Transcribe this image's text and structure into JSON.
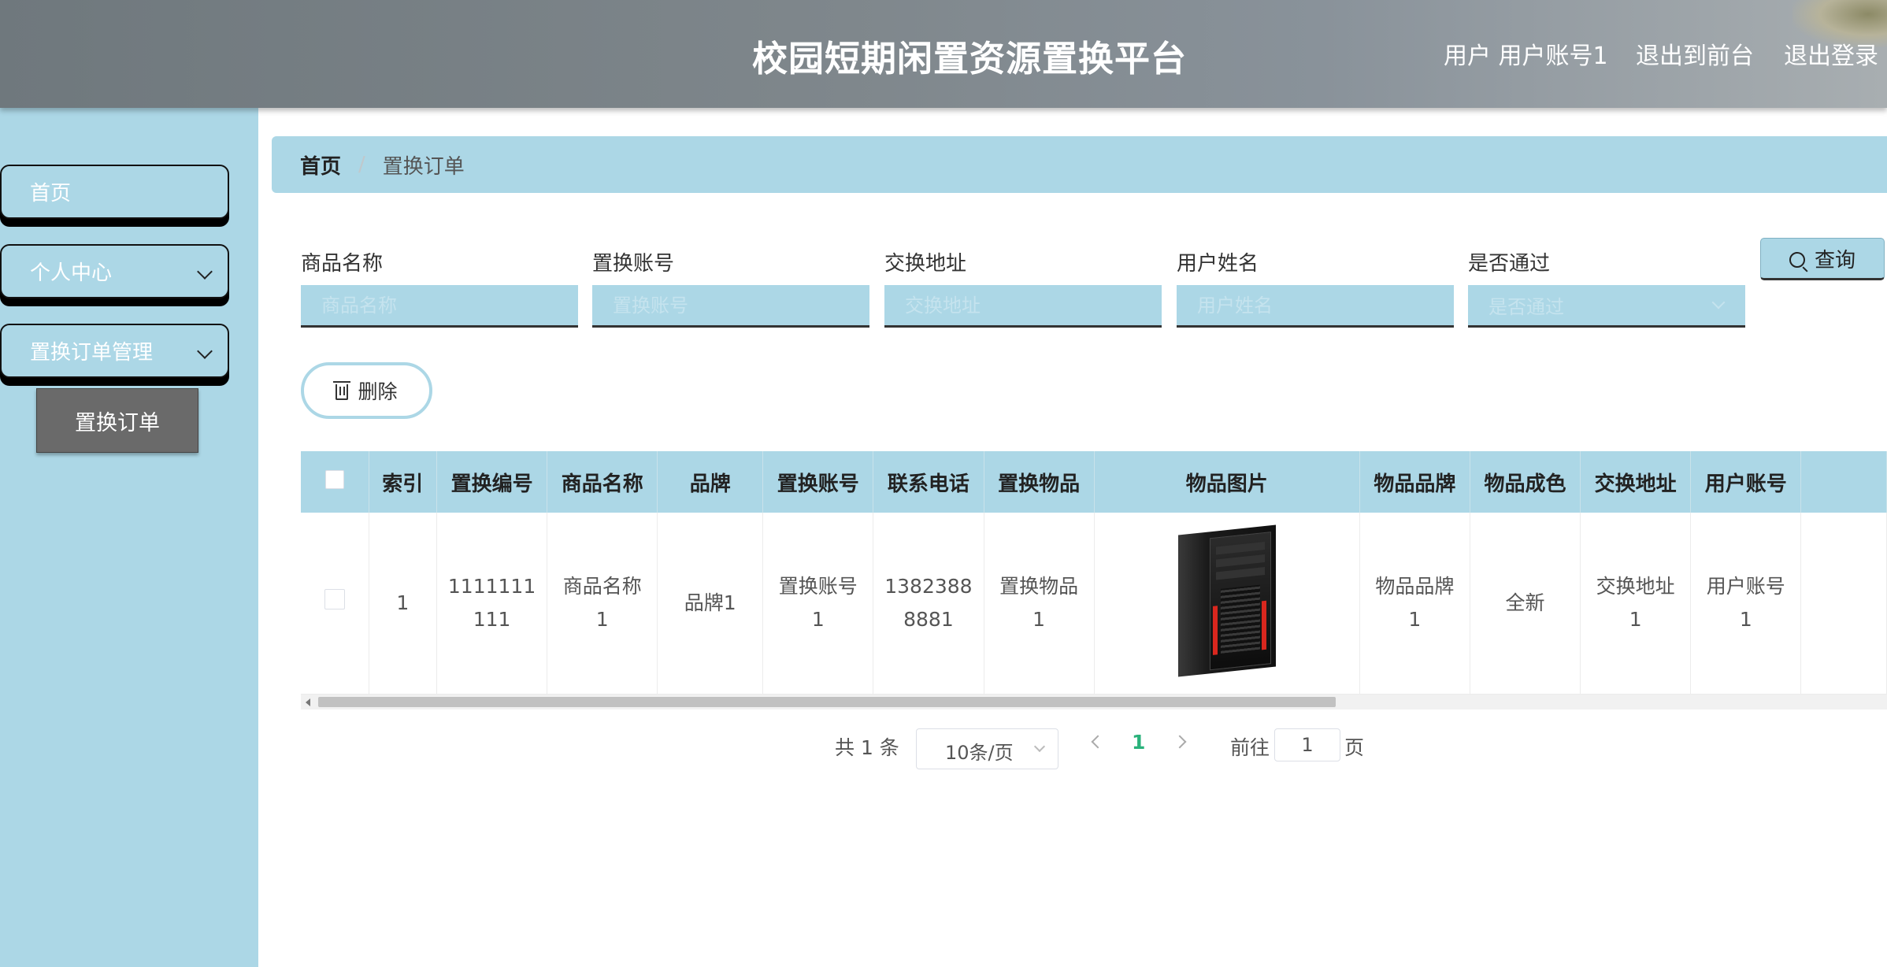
{
  "header": {
    "title": "校园短期闲置资源置换平台",
    "user_label": "用户 用户账号1",
    "front_link": "退出到前台",
    "logout_link": "退出登录"
  },
  "sidebar": {
    "items": [
      {
        "label": "首页"
      },
      {
        "label": "个人中心"
      },
      {
        "label": "置换订单管理"
      }
    ],
    "submenu": {
      "label": "置换订单"
    }
  },
  "breadcrumb": {
    "home": "首页",
    "separator": "/",
    "current": "置换订单"
  },
  "search": {
    "fields": [
      {
        "label": "商品名称",
        "placeholder": "商品名称"
      },
      {
        "label": "置换账号",
        "placeholder": "置换账号"
      },
      {
        "label": "交换地址",
        "placeholder": "交换地址"
      },
      {
        "label": "用户姓名",
        "placeholder": "用户姓名"
      },
      {
        "label": "是否通过",
        "placeholder": "是否通过"
      }
    ],
    "button_label": "查询"
  },
  "actions": {
    "delete_label": "删除"
  },
  "table": {
    "headers": [
      "索引",
      "置换编号",
      "商品名称",
      "品牌",
      "置换账号",
      "联系电话",
      "置换物品",
      "物品图片",
      "物品品牌",
      "物品成色",
      "交换地址",
      "用户账号"
    ],
    "rows": [
      {
        "index": "1",
        "exchange_no": "1111111111",
        "product_name": "商品名称1",
        "brand": "品牌1",
        "exchange_account": "置换账号1",
        "phone": "13823888881",
        "exchange_item": "置换物品1",
        "item_image": "pc-tower-image",
        "item_brand": "物品品牌1",
        "condition": "全新",
        "exchange_address": "交换地址1",
        "user_account": "用户账号1"
      }
    ]
  },
  "pagination": {
    "total": "共 1 条",
    "page_size": "10条/页",
    "current_page": "1",
    "goto_label": "前往",
    "goto_value": "1",
    "page_unit": "页"
  },
  "colors": {
    "accent": "#acd7e6",
    "header_bg": "#7f878c",
    "active_page": "#2ab27b"
  }
}
